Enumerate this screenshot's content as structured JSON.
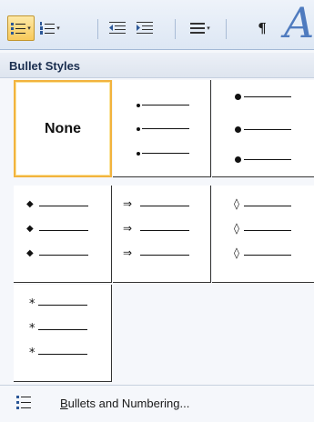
{
  "ribbon": {
    "buttons": [
      {
        "name": "bullets-button",
        "icon": "bullet-list-icon",
        "has_dropdown": true,
        "active": true
      },
      {
        "name": "numbering-button",
        "icon": "numbered-list-icon",
        "has_dropdown": true,
        "active": false
      },
      {
        "name": "decrease-indent-button",
        "icon": "decrease-indent-icon",
        "has_dropdown": false,
        "active": false
      },
      {
        "name": "increase-indent-button",
        "icon": "increase-indent-icon",
        "has_dropdown": false,
        "active": false
      },
      {
        "name": "sort-button",
        "icon": "sort-icon",
        "has_dropdown": true,
        "active": false
      },
      {
        "name": "show-formatting-button",
        "icon": "pilcrow-icon",
        "has_dropdown": false,
        "active": false
      }
    ],
    "pilcrow_glyph": "¶",
    "styles_glyph": "A",
    "dropdown_glyph": "▾",
    "accent_active": "#f8c95a"
  },
  "gallery": {
    "title": "Bullet Styles",
    "tiles": [
      {
        "name": "bullet-style-none",
        "label": "None",
        "selected": true
      },
      {
        "name": "bullet-style-small-dot",
        "symbol": "small-dot",
        "selected": false
      },
      {
        "name": "bullet-style-large-dot",
        "symbol": "large-dot",
        "selected": false
      },
      {
        "name": "bullet-style-diamond",
        "symbol": "◆",
        "selected": false
      },
      {
        "name": "bullet-style-arrow",
        "symbol": "⇒",
        "selected": false
      },
      {
        "name": "bullet-style-hollow-diamond",
        "symbol": "◊",
        "selected": false
      },
      {
        "name": "bullet-style-asterisk",
        "symbol": "*",
        "selected": false
      }
    ]
  },
  "footer": {
    "label_accel": "B",
    "label_rest": "ullets and Numbering...",
    "icon": "bullet-list-icon"
  }
}
